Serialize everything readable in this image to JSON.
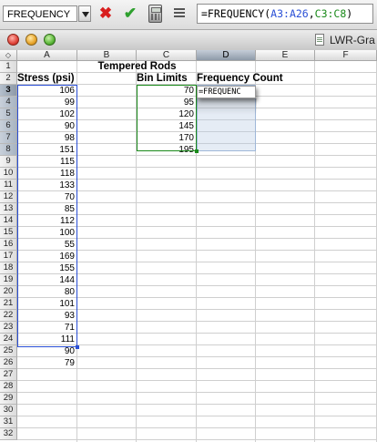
{
  "formula_bar": {
    "name_box": "FREQUENCY",
    "formula_prefix": "=FREQUENCY(",
    "range1": "A3:A26",
    "separator": ",",
    "range2": "C3:C8",
    "formula_suffix": ")",
    "cancel_icon": "x-cancel-icon",
    "enter_icon": "checkmark-enter-icon",
    "calc_icon": "calculator-icon",
    "equals_icon": "equals-icon"
  },
  "window": {
    "title": "LWR-Gra"
  },
  "columns": [
    "A",
    "B",
    "C",
    "D",
    "E",
    "F"
  ],
  "selected_column": "D",
  "rows": [
    "1",
    "2",
    "3",
    "4",
    "5",
    "6",
    "7",
    "8",
    "9",
    "10",
    "11",
    "12",
    "13",
    "14",
    "15",
    "16",
    "17",
    "18",
    "19",
    "20",
    "21",
    "22",
    "23",
    "24",
    "25",
    "26",
    "27",
    "28",
    "29",
    "30",
    "31",
    "32"
  ],
  "sheet": {
    "b1": "Tempered Rods",
    "a2": "Stress (psi)",
    "c2": "Bin Limits",
    "d2": "Frequency Count",
    "stress": [
      "106",
      "99",
      "102",
      "90",
      "98",
      "151",
      "115",
      "118",
      "133",
      "70",
      "85",
      "112",
      "100",
      "55",
      "169",
      "155",
      "144",
      "80",
      "101",
      "93",
      "71",
      "111",
      "90",
      "79"
    ],
    "bins": [
      "70",
      "95",
      "120",
      "145",
      "170",
      "195"
    ],
    "d3_edit": "=FREQUENC"
  },
  "colors": {
    "range1": "#2a4fd6",
    "range2": "#1a8a1a",
    "selection": "#b4c8e1"
  }
}
